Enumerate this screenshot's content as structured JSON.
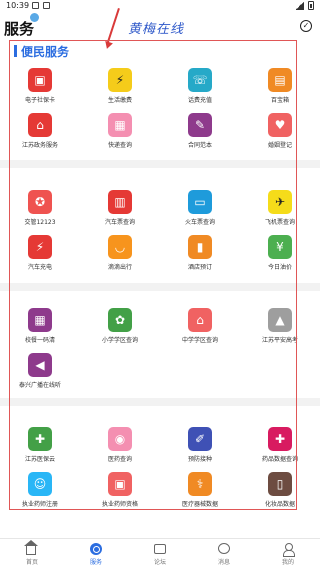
{
  "status_bar": {
    "time": "10:39"
  },
  "header": {
    "title": "服务",
    "handwriting": "黄梅在线"
  },
  "section": {
    "title": "便民服务"
  },
  "rows": [
    [
      {
        "label": "电子社保卡",
        "icon": "social-card-icon",
        "color": "#e53935",
        "glyph": "▣"
      },
      {
        "label": "生活缴费",
        "icon": "lightning-icon",
        "color": "#f5cc1a",
        "glyph": "⚡"
      },
      {
        "label": "话费充值",
        "icon": "phone-recharge-icon",
        "color": "#26a9c8",
        "glyph": "☏"
      },
      {
        "label": "百宝箱",
        "icon": "treasure-box-icon",
        "color": "#f08a24",
        "glyph": "▤"
      }
    ],
    [
      {
        "label": "江苏政务服务",
        "icon": "government-house-icon",
        "color": "#e53935",
        "glyph": "⌂"
      },
      {
        "label": "快递查询",
        "icon": "parcel-icon",
        "color": "#f48fb1",
        "glyph": "▦"
      },
      {
        "label": "合同范本",
        "icon": "contract-icon",
        "color": "#8e3a8c",
        "glyph": "✎"
      },
      {
        "label": "婚姻登记",
        "icon": "marriage-icon",
        "color": "#f06262",
        "glyph": "♥"
      }
    ],
    [
      {
        "label": "交管12123",
        "icon": "traffic-police-icon",
        "color": "#ef5350",
        "glyph": "✪"
      },
      {
        "label": "汽车票查询",
        "icon": "bus-icon",
        "color": "#e53935",
        "glyph": "▥"
      },
      {
        "label": "火车票查询",
        "icon": "train-icon",
        "color": "#1e9bdb",
        "glyph": "▭"
      },
      {
        "label": "飞机票查询",
        "icon": "airplane-icon",
        "color": "#f5dc1a",
        "glyph": "✈"
      }
    ],
    [
      {
        "label": "汽车充电",
        "icon": "ev-charger-icon",
        "color": "#e53935",
        "glyph": "⚡"
      },
      {
        "label": "滴滴出行",
        "icon": "didi-icon",
        "color": "#f7941d",
        "glyph": "◡"
      },
      {
        "label": "酒店预订",
        "icon": "hotel-icon",
        "color": "#f08a24",
        "glyph": "▮"
      },
      {
        "label": "今日油价",
        "icon": "oil-price-icon",
        "color": "#4caf50",
        "glyph": "¥"
      }
    ],
    [
      {
        "label": "校餐一码清",
        "icon": "qr-code-icon",
        "color": "#8e3a8c",
        "glyph": "▦"
      },
      {
        "label": "小学学区查询",
        "icon": "school-district-icon",
        "color": "#43a047",
        "glyph": "✿"
      },
      {
        "label": "中学学区查询",
        "icon": "school-building-icon",
        "color": "#f06262",
        "glyph": "⌂"
      },
      {
        "label": "江苏平安高考",
        "icon": "graduation-cap-icon",
        "color": "#9e9e9e",
        "glyph": "▲"
      }
    ],
    [
      {
        "label": "泰兴广播在线听",
        "icon": "broadcast-icon",
        "color": "#8e3a8c",
        "glyph": "◀"
      }
    ],
    [
      {
        "label": "江苏医保云",
        "icon": "medical-insurance-icon",
        "color": "#43a047",
        "glyph": "✚"
      },
      {
        "label": "医药查询",
        "icon": "medicine-icon",
        "color": "#f48fb1",
        "glyph": "◉"
      },
      {
        "label": "预防接种",
        "icon": "vaccine-icon",
        "color": "#3f51b5",
        "glyph": "✐"
      },
      {
        "label": "药品数据查询",
        "icon": "drug-data-icon",
        "color": "#d81b60",
        "glyph": "✚"
      }
    ],
    [
      {
        "label": "执业药师注册",
        "icon": "pharmacist-icon",
        "color": "#29b6f6",
        "glyph": "☺"
      },
      {
        "label": "执业药师资格",
        "icon": "pharmacist-certificate-icon",
        "color": "#f06262",
        "glyph": "▣"
      },
      {
        "label": "医疗器械数据",
        "icon": "medical-device-icon",
        "color": "#f08a24",
        "glyph": "⚕"
      },
      {
        "label": "化妆品数据",
        "icon": "cosmetics-icon",
        "color": "#6d4c41",
        "glyph": "▯"
      }
    ]
  ],
  "bottom_nav": [
    {
      "label": "首页",
      "icon": "home-icon"
    },
    {
      "label": "服务",
      "icon": "service-icon",
      "active": true
    },
    {
      "label": "论坛",
      "icon": "forum-icon"
    },
    {
      "label": "消息",
      "icon": "message-icon"
    },
    {
      "label": "我的",
      "icon": "profile-icon"
    }
  ]
}
